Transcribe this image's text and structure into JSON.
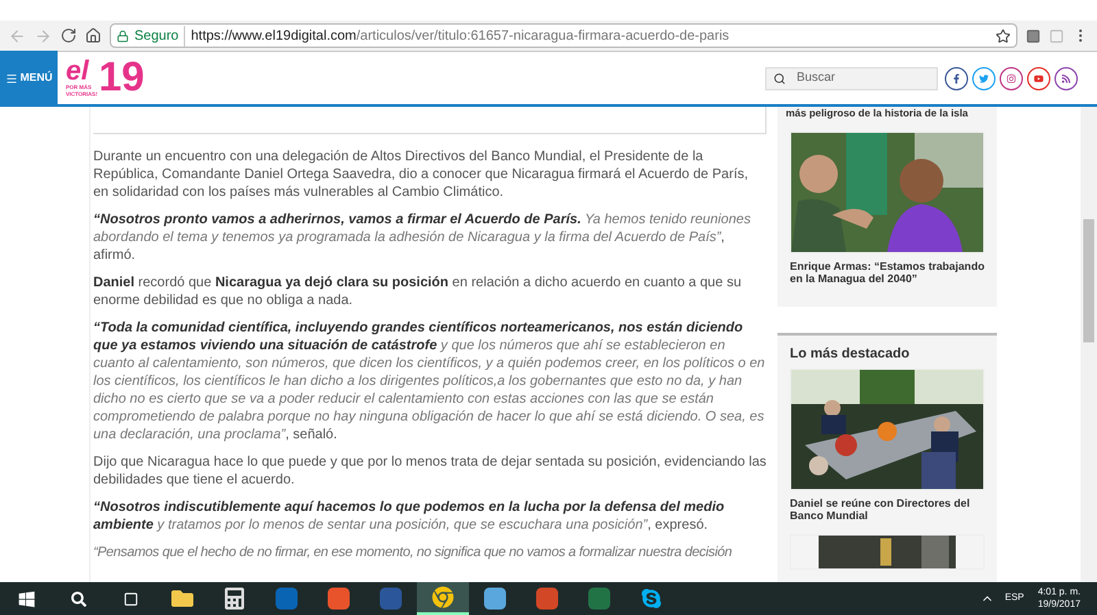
{
  "browser": {
    "secure_label": "Seguro",
    "url_host": "https://www.el19digital.com",
    "url_path": "/articulos/ver/titulo:61657-nicaragua-firmara-acuerdo-de-paris"
  },
  "header": {
    "menu_label": "MENÚ",
    "logo": {
      "el": "el",
      "number": "19",
      "tagline": "POR MÁS VICTORIAS!"
    },
    "search": {
      "placeholder": "Buscar"
    },
    "social": [
      {
        "kind": "facebook",
        "color": "#3b5998"
      },
      {
        "kind": "twitter",
        "color": "#1da1f2"
      },
      {
        "kind": "instagram",
        "color": "#c13584"
      },
      {
        "kind": "youtube",
        "color": "#e52d27"
      },
      {
        "kind": "rss",
        "color": "#8e44ad"
      }
    ]
  },
  "article": {
    "paragraphs": [
      [
        {
          "kind": "plain",
          "text": "Durante un encuentro con una delegación de Altos Directivos del Banco Mundial, el Presidente de la República, Comandante Daniel Ortega Saavedra, dio a conocer que Nicaragua firmará el Acuerdo de París, en solidaridad con los países más vulnerables al Cambio Climático."
        }
      ],
      [
        {
          "kind": "bold-italic",
          "text": "“Nosotros pronto vamos a adherirnos, vamos a firmar el Acuerdo de París."
        },
        {
          "kind": "italic",
          "text": " Ya hemos tenido reuniones abordando el tema y tenemos ya programada la adhesión de Nicaragua y la firma del Acuerdo de País”"
        },
        {
          "kind": "plain",
          "text": ", afirmó."
        }
      ],
      [
        {
          "kind": "bold",
          "text": "Daniel"
        },
        {
          "kind": "plain",
          "text": " recordó que "
        },
        {
          "kind": "bold",
          "text": "Nicaragua ya dejó clara su posición"
        },
        {
          "kind": "plain",
          "text": " en relación a dicho acuerdo en cuanto a que su enorme debilidad es que no obliga a nada."
        }
      ],
      [
        {
          "kind": "bold-italic",
          "text": "“Toda la comunidad científica, incluyendo grandes científicos norteamericanos, nos están diciendo que ya estamos viviendo una situación de catástrofe"
        },
        {
          "kind": "italic",
          "text": " y que los números que ahí se establecieron en cuanto al calentamiento, son números, que dicen los científicos, y a quién podemos creer, en los políticos o en los científicos, los científicos le han dicho a los dirigentes políticos,a los gobernantes que esto no da, y han dicho no es cierto que se va a poder reducir el calentamiento con estas acciones con las que se están comprometiendo de palabra porque no hay ninguna obligación de hacer lo que ahí se está diciendo. O sea, es una declaración, una proclama”"
        },
        {
          "kind": "plain",
          "text": ", señaló."
        }
      ],
      [
        {
          "kind": "plain",
          "text": "Dijo que Nicaragua hace lo que puede y que por lo menos trata de dejar sentada su posición, evidenciando las debilidades que tiene el acuerdo."
        }
      ],
      [
        {
          "kind": "bold-italic",
          "text": "“Nosotros indiscutiblemente aquí hacemos lo que podemos en la lucha por la defensa del medio ambiente"
        },
        {
          "kind": "italic",
          "text": " y tratamos por lo menos de sentar una posición, que se escuchara una posición”"
        },
        {
          "kind": "plain",
          "text": ", expresó."
        }
      ],
      [
        {
          "kind": "italic",
          "text": "“Pensamos que el hecho de no firmar, en ese momento, no significa que no vamos a formalizar nuestra decisión"
        }
      ]
    ]
  },
  "sidebar": {
    "cut_title": "más peligroso de la historia de la isla",
    "story": {
      "title": "Enrique Armas: “Estamos trabajando en la Managua del 2040”"
    },
    "section_title": "Lo más destacado",
    "featured": {
      "title": "Daniel se reúne con Directores del Banco Mundial"
    }
  },
  "taskbar": {
    "apps": [
      {
        "kind": "explorer",
        "selected": false
      },
      {
        "kind": "calculator",
        "selected": false
      },
      {
        "kind": "outlook",
        "selected": false
      },
      {
        "kind": "office",
        "selected": false
      },
      {
        "kind": "word",
        "selected": false
      },
      {
        "kind": "chrome",
        "selected": true
      },
      {
        "kind": "remote",
        "selected": false
      },
      {
        "kind": "powerpoint",
        "selected": false
      },
      {
        "kind": "excel",
        "selected": false
      },
      {
        "kind": "skype",
        "selected": false
      }
    ],
    "language": "ESP",
    "time": "4:01 p. m.",
    "date": "19/9/2017"
  }
}
